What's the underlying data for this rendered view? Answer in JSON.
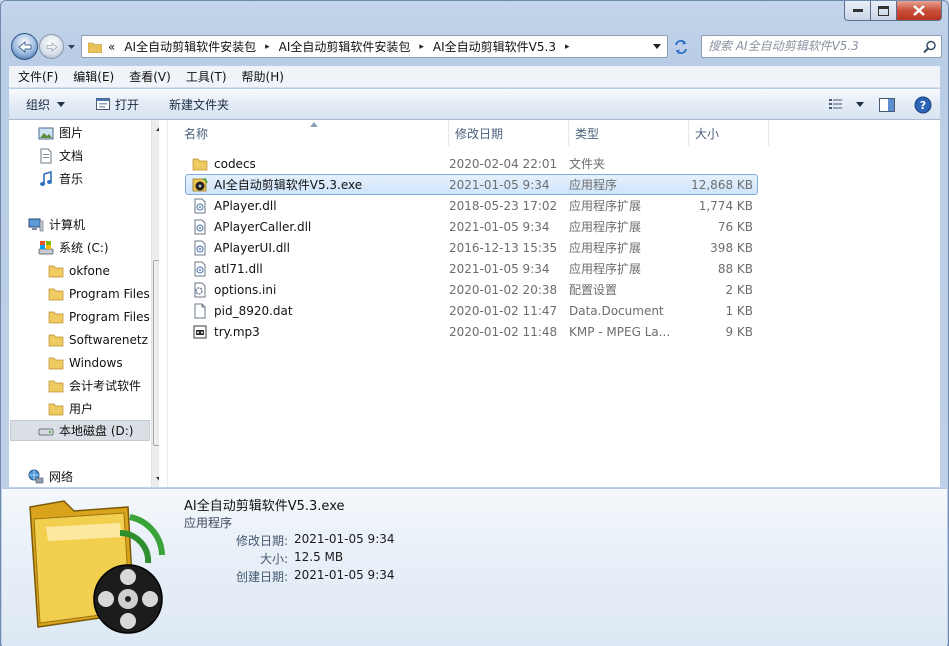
{
  "window": {
    "address": {
      "overflow_glyph": "«",
      "crumbs": [
        "AI全自动剪辑软件安装包",
        "AI全自动剪辑软件安装包",
        "AI全自动剪辑软件V5.3"
      ],
      "separator": "▸"
    },
    "search": {
      "placeholder": "搜索 AI全自动剪辑软件V5.3"
    }
  },
  "menubar": {
    "items": [
      "文件(F)",
      "编辑(E)",
      "查看(V)",
      "工具(T)",
      "帮助(H)"
    ]
  },
  "commandbar": {
    "organize": "组织",
    "open": "打开",
    "new_folder": "新建文件夹"
  },
  "navpane": {
    "items": [
      {
        "label": "图片",
        "icon": "pictures-icon"
      },
      {
        "label": "文档",
        "icon": "documents-icon"
      },
      {
        "label": "音乐",
        "icon": "music-icon"
      },
      {
        "label": "计算机",
        "icon": "computer-icon"
      },
      {
        "label": "系统 (C:)",
        "icon": "drive-c-icon"
      },
      {
        "label": "okfone",
        "icon": "folder-icon"
      },
      {
        "label": "Program Files",
        "icon": "folder-icon"
      },
      {
        "label": "Program Files",
        "icon": "folder-icon"
      },
      {
        "label": "Softwarenetz",
        "icon": "folder-icon"
      },
      {
        "label": "Windows",
        "icon": "folder-icon"
      },
      {
        "label": "会计考试软件",
        "icon": "folder-icon"
      },
      {
        "label": "用户",
        "icon": "folder-icon"
      },
      {
        "label": "本地磁盘 (D:)",
        "icon": "drive-d-icon"
      },
      {
        "label": "网络",
        "icon": "network-icon"
      }
    ]
  },
  "filelist": {
    "columns": {
      "name": "名称",
      "date": "修改日期",
      "type": "类型",
      "size": "大小"
    },
    "rows": [
      {
        "name": "codecs",
        "date": "2020-02-04 22:01",
        "type": "文件夹",
        "size": "",
        "icon": "folder-icon"
      },
      {
        "name": "AI全自动剪辑软件V5.3.exe",
        "date": "2021-01-05 9:34",
        "type": "应用程序",
        "size": "12,868 KB",
        "icon": "exe-icon",
        "selected": true
      },
      {
        "name": "APlayer.dll",
        "date": "2018-05-23 17:02",
        "type": "应用程序扩展",
        "size": "1,774 KB",
        "icon": "dll-icon"
      },
      {
        "name": "APlayerCaller.dll",
        "date": "2021-01-05 9:34",
        "type": "应用程序扩展",
        "size": "76 KB",
        "icon": "dll-icon"
      },
      {
        "name": "APlayerUI.dll",
        "date": "2016-12-13 15:35",
        "type": "应用程序扩展",
        "size": "398 KB",
        "icon": "dll-icon"
      },
      {
        "name": "atl71.dll",
        "date": "2021-01-05 9:34",
        "type": "应用程序扩展",
        "size": "88 KB",
        "icon": "dll-icon"
      },
      {
        "name": "options.ini",
        "date": "2020-01-02 20:38",
        "type": "配置设置",
        "size": "2 KB",
        "icon": "ini-icon"
      },
      {
        "name": "pid_8920.dat",
        "date": "2020-01-02 11:47",
        "type": "Data.Document",
        "size": "1 KB",
        "icon": "dat-icon"
      },
      {
        "name": "try.mp3",
        "date": "2020-01-02 11:48",
        "type": "KMP - MPEG La...",
        "size": "9 KB",
        "icon": "mp3-icon"
      }
    ]
  },
  "details": {
    "title": "AI全自动剪辑软件V5.3.exe",
    "type": "应用程序",
    "modified_label": "修改日期:",
    "modified_value": "2021-01-05 9:34",
    "size_label": "大小:",
    "size_value": "12.5 MB",
    "created_label": "创建日期:",
    "created_value": "2021-01-05 9:34"
  },
  "colors": {
    "selection_fill": "#cfe4fb",
    "selection_border": "#84acdd",
    "chrome": "#bfd1e8"
  }
}
